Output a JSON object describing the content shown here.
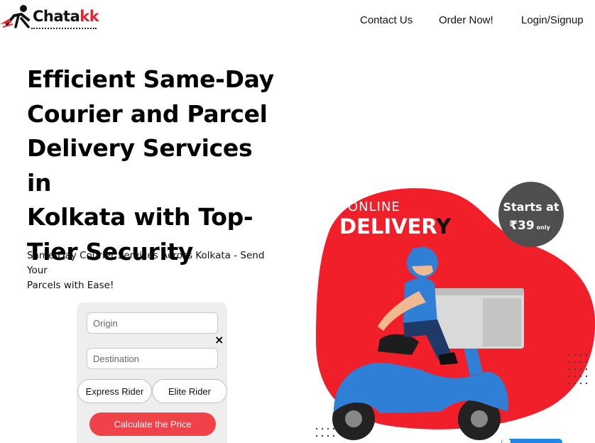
{
  "header": {
    "logo_text_main": "Chata",
    "logo_text_accent": "kk",
    "nav": {
      "contact": "Contact Us",
      "order": "Order Now!",
      "login": "Login/Signup"
    }
  },
  "hero": {
    "title_lines": [
      "Efficient Same-Day",
      "Courier and Parcel",
      "Delivery Services in",
      "Kolkata with Top-",
      "Tier Security"
    ],
    "subtitle_lines": [
      "Same-Day Courier Services Across Kolkata - Send Your",
      "Parcels with Ease!"
    ]
  },
  "form": {
    "origin_placeholder": "Origin",
    "destination_placeholder": "Destination",
    "clear_symbol": "×",
    "rider_options": [
      "Express Rider",
      "Elite Rider"
    ],
    "submit_label": "Calculate the Price"
  },
  "promo": {
    "line1": "ONLINE",
    "line2_main": "DELIVER",
    "line2_end": "Y",
    "badge_top": "Starts at",
    "badge_price": "₹39",
    "badge_suffix": "only"
  },
  "colors": {
    "brand_red": "#e8232f",
    "button_red": "#f04248",
    "form_bg": "#eeeeee",
    "badge_gray": "#4f4f4f",
    "scooter_blue": "#2f7fd6"
  }
}
